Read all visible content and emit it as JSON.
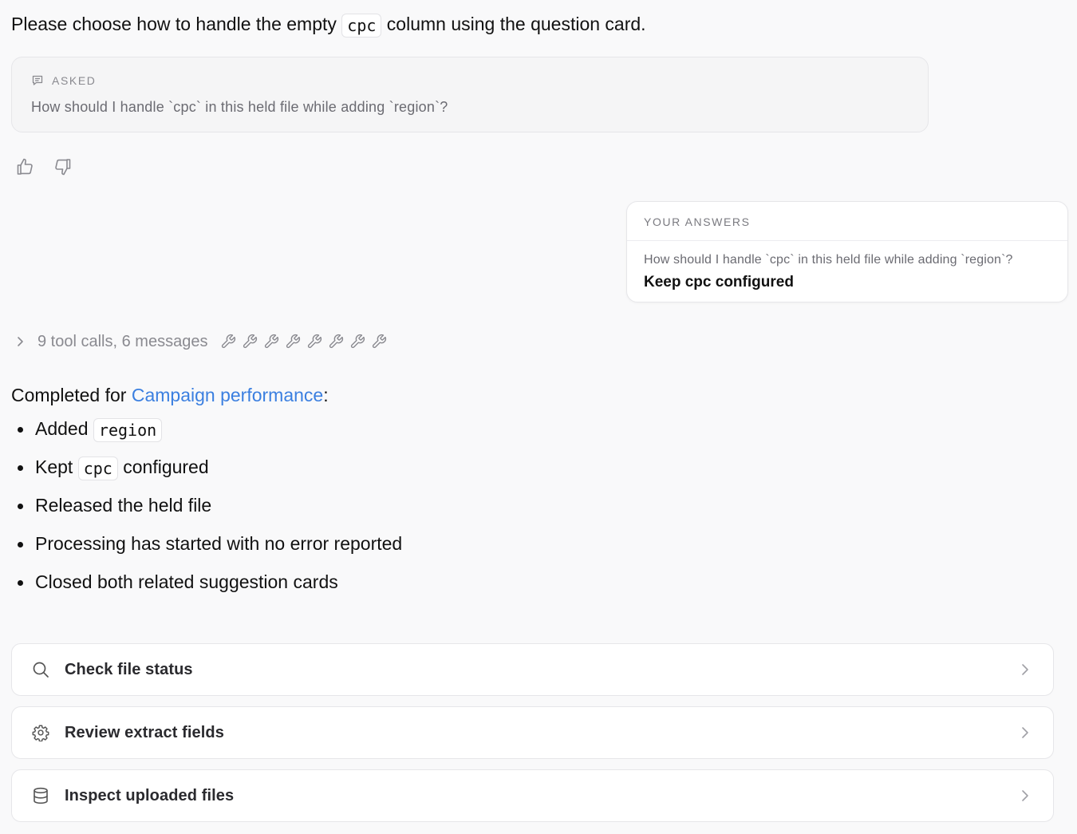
{
  "intro": {
    "before": "Please choose how to handle the empty",
    "code": "cpc",
    "after": "column using the question card."
  },
  "asked": {
    "header": "ASKED",
    "icon": "message-square-icon",
    "question": "How should I handle `cpc` in this held file while adding `region`?"
  },
  "feedback": {
    "thumbs_up_icon": "thumbs-up-icon",
    "thumbs_down_icon": "thumbs-down-icon"
  },
  "answers": {
    "header": "YOUR ANSWERS",
    "question": "How should I handle `cpc` in this held file while adding `region`?",
    "answer": "Keep cpc configured"
  },
  "toolcalls": {
    "label": "9 tool calls, 6 messages",
    "wrench_count": 8
  },
  "completed": {
    "prefix": "Completed for",
    "link": "Campaign performance",
    "suffix": ":",
    "bullets": [
      {
        "before": "Added",
        "code": "region",
        "after": ""
      },
      {
        "before": "Kept",
        "code": "cpc",
        "after": "configured"
      },
      {
        "before": "Released the held file",
        "code": "",
        "after": ""
      },
      {
        "before": "Processing has started with no error reported",
        "code": "",
        "after": ""
      },
      {
        "before": "Closed both related suggestion cards",
        "code": "",
        "after": ""
      }
    ]
  },
  "actions": [
    {
      "label": "Check file status",
      "icon": "search-icon"
    },
    {
      "label": "Review extract fields",
      "icon": "gear-icon"
    },
    {
      "label": "Inspect uploaded files",
      "icon": "database-icon"
    }
  ],
  "colors": {
    "link": "#3b7fe0",
    "muted": "#8a8a90",
    "background": "#f9f9fa"
  }
}
